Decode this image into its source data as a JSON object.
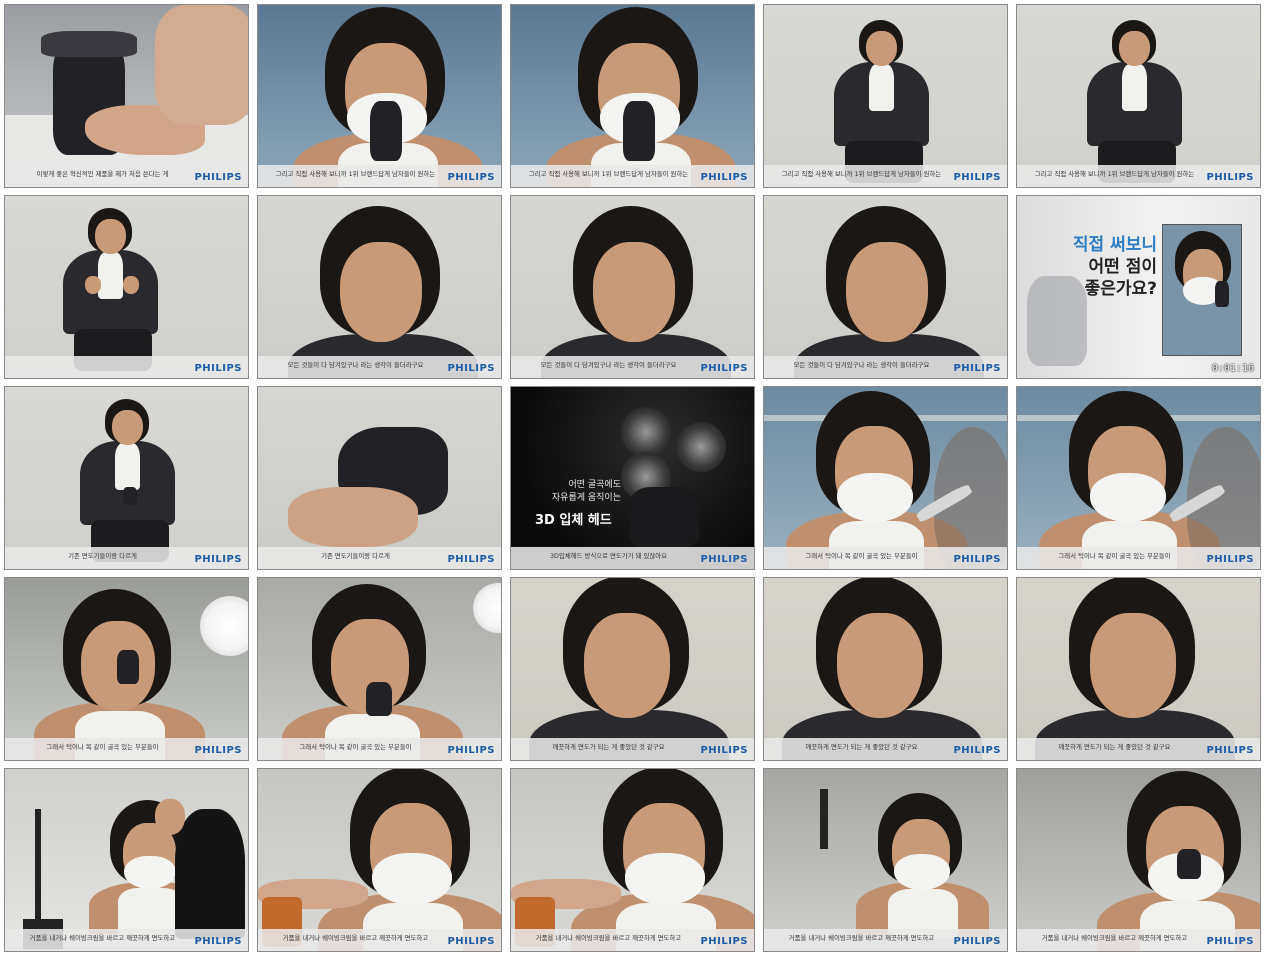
{
  "sheet": {
    "columns": 5,
    "rows": 5
  },
  "colors": {
    "brand_blue": "#1e5ca8",
    "studio_grey": "#d5d6d2",
    "thumb_border": "#8a8a8a",
    "promo_black": "#0a0a0a",
    "headline_blue": "#2c7dc3",
    "headline_dark": "#222222"
  },
  "thumbnails": [
    {
      "scene": "hand-shaver",
      "caption": "이렇게 좋은 혁신적인 제품을 제가 처음 쓴다는 게",
      "logo": "PHILIPS"
    },
    {
      "scene": "shave-closeup",
      "caption": "그리고 직접 사용해 보니까 1위 브랜드답게 남자들이 원하는",
      "logo": "PHILIPS"
    },
    {
      "scene": "shave-closeup",
      "caption": "그리고 직접 사용해 보니까 1위 브랜드답게 남자들이 원하는",
      "logo": "PHILIPS"
    },
    {
      "scene": "seated-wide",
      "caption": "그리고 직접 사용해 보니까 1위 브랜드답게 남자들이 원하는",
      "logo": "PHILIPS"
    },
    {
      "scene": "seated-wide",
      "caption": "그리고 직접 사용해 보니까 1위 브랜드답게 남자들이 원하는",
      "logo": "PHILIPS"
    },
    {
      "scene": "seated-gesture",
      "caption": "",
      "logo": "PHILIPS"
    },
    {
      "scene": "face-closeup",
      "caption": "모든 것들이 다 담겨있구나 라는 생각이 들더라구요",
      "logo": "PHILIPS"
    },
    {
      "scene": "face-closeup",
      "caption": "모든 것들이 다 담겨있구나 라는 생각이 들더라구요",
      "logo": "PHILIPS"
    },
    {
      "scene": "face-closeup",
      "caption": "모든 것들이 다 담겨있구나 라는 생각이 들더라구요",
      "logo": "PHILIPS"
    },
    {
      "scene": "title-card",
      "caption": "",
      "logo": "",
      "headline": [
        "직접 써보니",
        "어떤 점이",
        "좋은가요?"
      ],
      "timestamp": "0:01:16"
    },
    {
      "scene": "seated-shaver",
      "caption": "기존 면도기들이랑 다르게",
      "logo": "PHILIPS"
    },
    {
      "scene": "hand-product",
      "caption": "기존 면도기들이랑 다르게",
      "logo": "PHILIPS"
    },
    {
      "scene": "product-promo",
      "caption": "3D입체헤드 방식으로 면도가가 돼 있잖아요",
      "logo": "PHILIPS",
      "promo_lines": [
        "어떤 굴곡에도",
        "자유롭게 움직이는"
      ],
      "promo_title": "3D 입체 헤드"
    },
    {
      "scene": "mirror-shave",
      "caption": "그래서 턱이나 목 같이 굴곡 있는 부분들이",
      "logo": "PHILIPS"
    },
    {
      "scene": "mirror-shave",
      "caption": "그래서 턱이나 목 같이 굴곡 있는 부분들이",
      "logo": "PHILIPS"
    },
    {
      "scene": "studio-shave",
      "caption": "그래서 턱이나 목 같이 굴곡 있는 부분들이",
      "logo": "PHILIPS"
    },
    {
      "scene": "studio-shave2",
      "caption": "그래서 턱이나 목 같이 굴곡 있는 부분들이",
      "logo": "PHILIPS"
    },
    {
      "scene": "jacket-closeup",
      "caption": "깨끗하게 면도가 되는 게 좋았던 것 같구요",
      "logo": "PHILIPS"
    },
    {
      "scene": "jacket-closeup",
      "caption": "깨끗하게 면도가 되는 게 좋았던 것 같구요",
      "logo": "PHILIPS"
    },
    {
      "scene": "jacket-closeup",
      "caption": "깨끗하게 면도가 되는 게 좋았던 것 같구요",
      "logo": "PHILIPS"
    },
    {
      "scene": "makeup-wide",
      "caption": "거품을 내거나 쉐이빙크림을 바르고 깨끗하게 면도하고",
      "logo": "PHILIPS"
    },
    {
      "scene": "makeup-close",
      "caption": "거품을 내거나 쉐이빙크림을 바르고 깨끗하게 면도하고",
      "logo": "PHILIPS"
    },
    {
      "scene": "makeup-close",
      "caption": "거품을 내거나 쉐이빙크림을 바르고 깨끗하게 면도하고",
      "logo": "PHILIPS"
    },
    {
      "scene": "studio-foam",
      "caption": "거품을 내거나 쉐이빙크림을 바르고 깨끗하게 면도하고",
      "logo": "PHILIPS"
    },
    {
      "scene": "foam-closeup",
      "caption": "거품을 내거나 쉐이빙크림을 바르고 깨끗하게 면도하고",
      "logo": "PHILIPS"
    }
  ]
}
